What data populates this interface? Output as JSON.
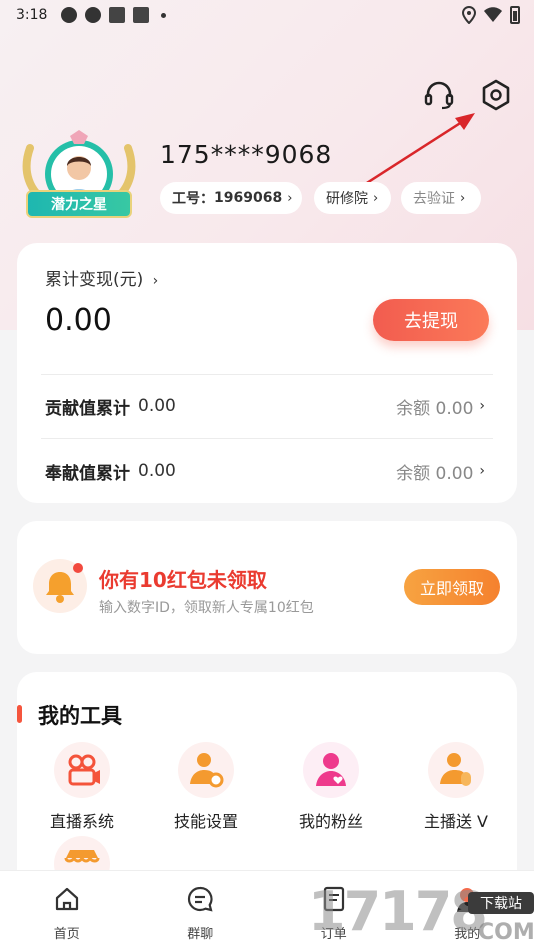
{
  "status_bar": {
    "time": "3:18",
    "icons": [
      "signal-app-icon",
      "signal-app-icon",
      "square-notification-icon",
      "square-notification-icon",
      "dot-icon"
    ],
    "right_icons": [
      "location-icon",
      "wifi-icon",
      "battery-icon"
    ]
  },
  "header": {
    "support_icon": "headset-icon",
    "settings_icon": "hexagon-settings-icon"
  },
  "profile": {
    "badge_text": "潜力之星",
    "phone": "175****9068",
    "job_no_label": "工号：",
    "job_no_value": "1969068",
    "academy_label": "研修院",
    "verify_label": "去验证",
    "chevron": "›"
  },
  "balance": {
    "cumulative_label": "累计变现(元)",
    "cumulative_chevron": "›",
    "amount": "0.00",
    "withdraw_button": "去提现",
    "rows": [
      {
        "label": "贡献值累计",
        "value": "0.00",
        "balance": "余额 0.00",
        "chevron": "›"
      },
      {
        "label": "奉献值累计",
        "value": "0.00",
        "balance": "余额 0.00",
        "chevron": "›"
      }
    ]
  },
  "red_packet": {
    "title": "你有10红包未领取",
    "subtitle": "输入数字ID，领取新人专属10红包",
    "claim_button": "立即领取"
  },
  "tools": {
    "title": "我的工具",
    "items": [
      {
        "label": "直播系统",
        "icon": "live-camera-icon"
      },
      {
        "label": "技能设置",
        "icon": "user-gear-icon"
      },
      {
        "label": "我的粉丝",
        "icon": "fans-heart-icon"
      },
      {
        "label": "主播送 V",
        "icon": "user-coin-icon"
      },
      {
        "label": "",
        "icon": "store-awning-icon"
      }
    ]
  },
  "bottom_nav": [
    {
      "label": "首页",
      "icon": "home-icon"
    },
    {
      "label": "群聊",
      "icon": "chat-icon"
    },
    {
      "label": "订单",
      "icon": "order-icon"
    },
    {
      "label": "我的",
      "icon": "profile-icon"
    }
  ],
  "watermark": {
    "digits": "17178",
    "badge": "下载站",
    "suffix": "COM"
  },
  "colors": {
    "accent_red": "#f25c4f",
    "accent_orange": "#f5812e",
    "title_red": "#ea3b30",
    "annotation_arrow": "#d9262a"
  }
}
